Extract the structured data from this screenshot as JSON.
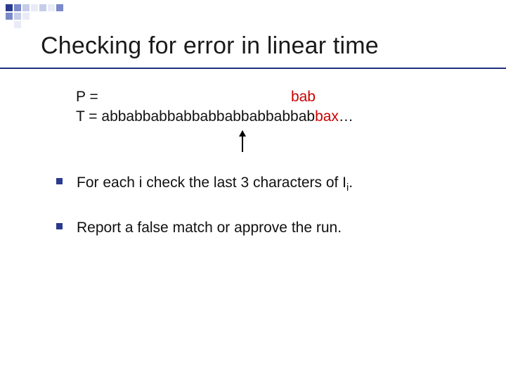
{
  "title": "Checking for error in linear time",
  "pt": {
    "p_label": "P = ",
    "p_value_red": "bab",
    "t_label": "T = ",
    "t_value_black": "abbabbabbabbabbabbabbabbab",
    "t_value_red": "bax",
    "t_tail": "…"
  },
  "bullets": [
    {
      "text_pre": "For each i check the last 3 characters of I",
      "sub": "i",
      "text_post": "."
    },
    {
      "text_pre": "Report a false match or approve the run.",
      "sub": "",
      "text_post": ""
    }
  ]
}
